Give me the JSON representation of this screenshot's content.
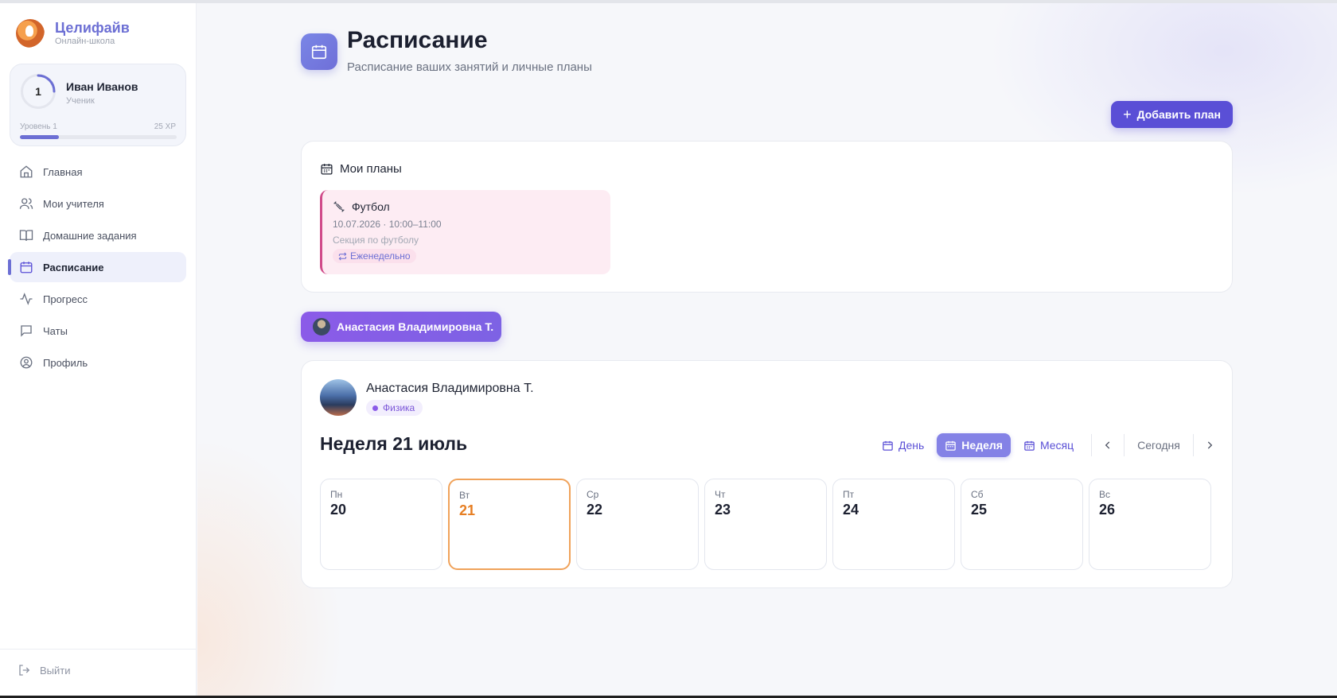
{
  "brand": {
    "name": "Целифайв",
    "subtitle": "Онлайн-школа"
  },
  "user": {
    "name": "Иван Иванов",
    "role": "Ученик",
    "level_number": "1",
    "level_label": "Уровень 1",
    "xp_label": "25 XP",
    "xp_progress_percent": 25
  },
  "nav": {
    "items": [
      {
        "label": "Главная",
        "icon": "home-icon"
      },
      {
        "label": "Мои учителя",
        "icon": "users-icon"
      },
      {
        "label": "Домашние задания",
        "icon": "book-icon"
      },
      {
        "label": "Расписание",
        "icon": "calendar-icon",
        "active": true
      },
      {
        "label": "Прогресс",
        "icon": "activity-icon"
      },
      {
        "label": "Чаты",
        "icon": "chat-icon"
      },
      {
        "label": "Профиль",
        "icon": "profile-icon"
      }
    ],
    "logout": "Выйти"
  },
  "page": {
    "title": "Расписание",
    "subtitle": "Расписание ваших занятий и личные планы",
    "add_plan": "Добавить план"
  },
  "plans": {
    "header": "Мои планы",
    "items": [
      {
        "title": "Футбол",
        "time": "10.07.2026 · 10:00–11:00",
        "description": "Секция по футболу",
        "repeat": "Еженедельно",
        "accent_color": "#d04b8a"
      }
    ]
  },
  "teacher_tab": {
    "label": "Анастасия Владимировна Т."
  },
  "schedule": {
    "teacher_name": "Анастасия Владимировна Т.",
    "subject": "Физика",
    "week_title": "Неделя 21 июль",
    "views": {
      "day": "День",
      "week": "Неделя",
      "month": "Месяц",
      "active": "week"
    },
    "today_label": "Сегодня",
    "days": [
      {
        "name": "Пн",
        "num": "20"
      },
      {
        "name": "Вт",
        "num": "21",
        "today": true
      },
      {
        "name": "Ср",
        "num": "22"
      },
      {
        "name": "Чт",
        "num": "23"
      },
      {
        "name": "Пт",
        "num": "24"
      },
      {
        "name": "Сб",
        "num": "25"
      },
      {
        "name": "Вс",
        "num": "26"
      }
    ]
  },
  "colors": {
    "accent": "#5a4fd6",
    "brand": "#6c6fd4",
    "today": "#e67e22",
    "teacher_tab": "#8b5be8"
  }
}
